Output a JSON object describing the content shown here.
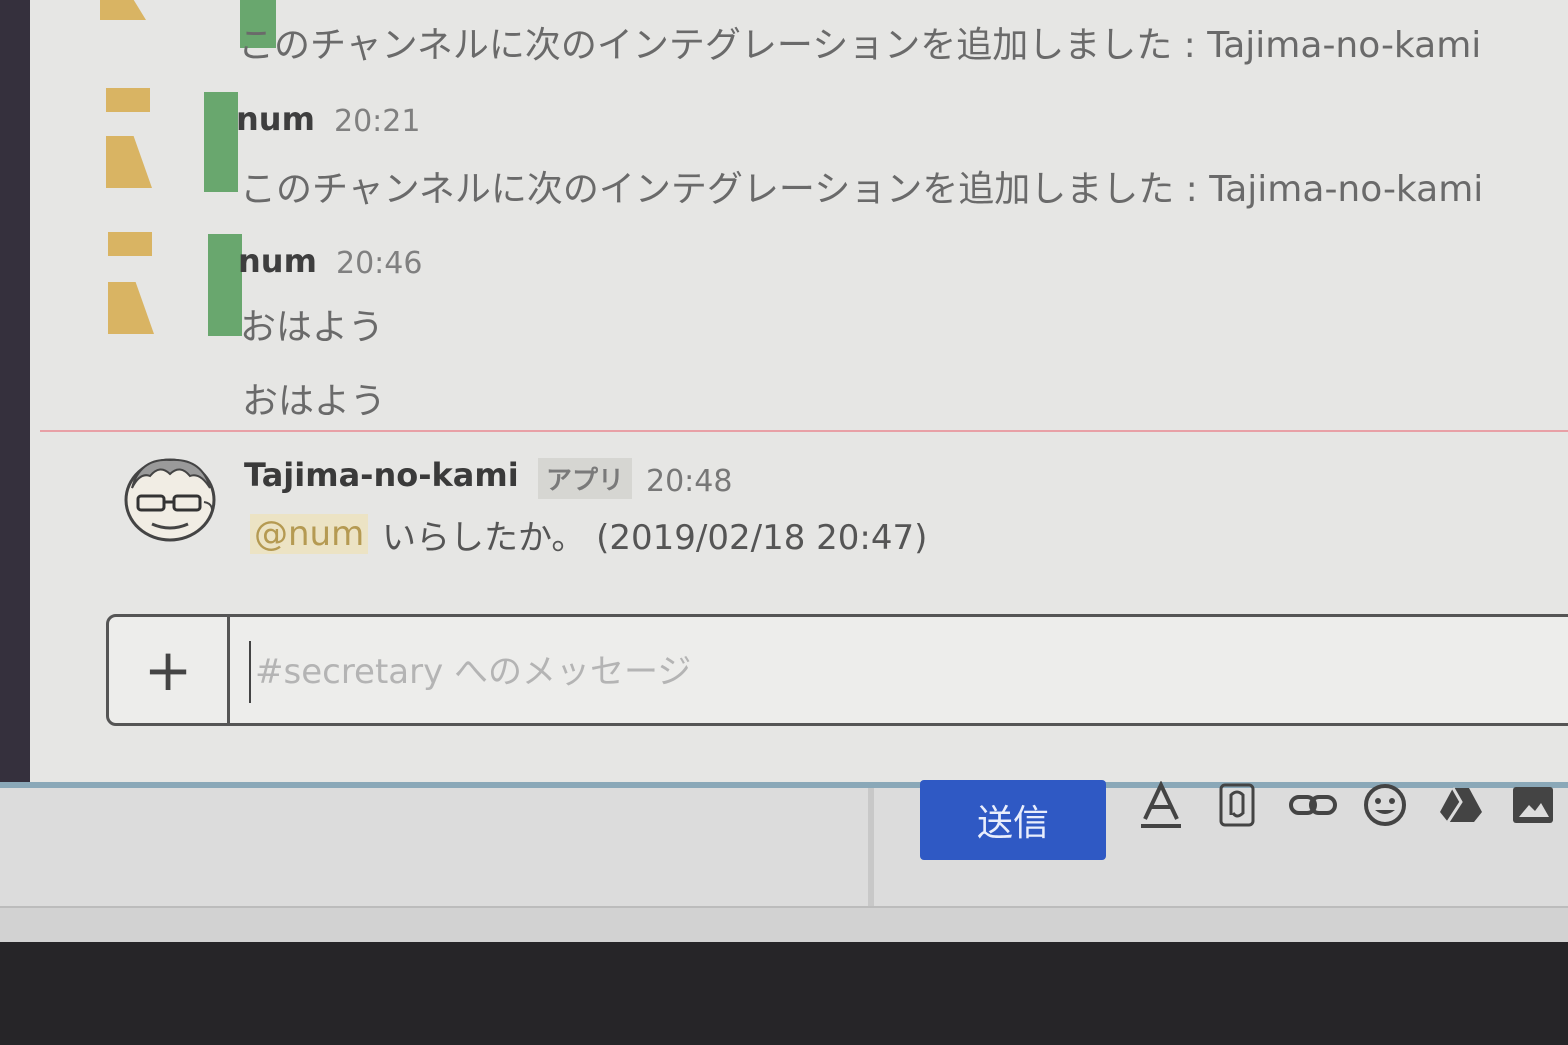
{
  "messages": [
    {
      "sender": "",
      "time": "",
      "lines": [
        "このチャンネルに次のインテグレーションを追加しました : Tajima-no-kami"
      ]
    },
    {
      "sender": "num",
      "time": "20:21",
      "lines": [
        "このチャンネルに次のインテグレーションを追加しました : Tajima-no-kami"
      ]
    },
    {
      "sender": "num",
      "time": "20:46",
      "lines": [
        "おはよう",
        "おはよう"
      ]
    }
  ],
  "bot_message": {
    "sender": "Tajima-no-kami",
    "badge": "アプリ",
    "time": "20:48",
    "mention": "@num",
    "text": "いらしたか。 (2019/02/18 20:47)"
  },
  "composer": {
    "plus_label": "+",
    "placeholder": "#secretary へのメッセージ"
  },
  "toolbar": {
    "send_label": "送信",
    "icons": [
      "text-format-icon",
      "attachment-icon",
      "link-icon",
      "emoji-icon",
      "drive-icon",
      "image-icon"
    ]
  },
  "colors": {
    "identicon_yellow": "#d9b463",
    "identicon_green": "#69a76e",
    "send_button": "#2f59c4",
    "unread_divider": "#e8a0a6"
  }
}
